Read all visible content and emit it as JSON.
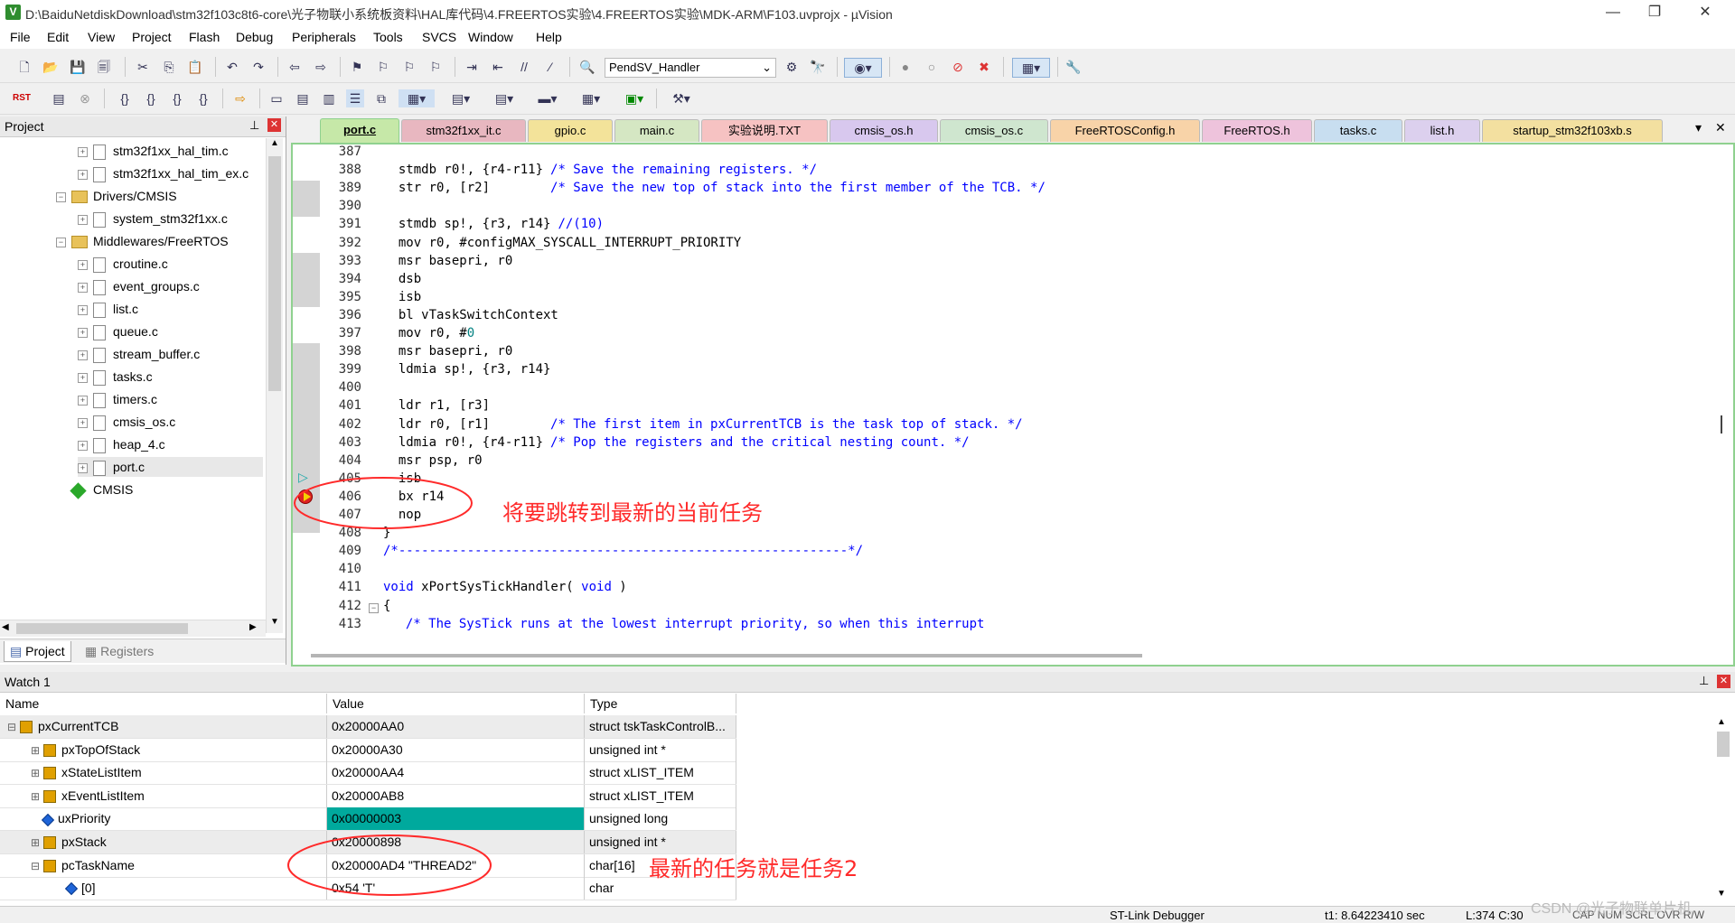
{
  "window": {
    "title": "D:\\BaiduNetdiskDownload\\stm32f103c8t6-core\\光子物联小系统板资料\\HAL库代码\\4.FREERTOS实验\\4.FREERTOS实验\\MDK-ARM\\F103.uvprojx - µVision",
    "app_icon": "V",
    "minimize": "—",
    "maximize": "❐",
    "close": "✕"
  },
  "menu": [
    "File",
    "Edit",
    "View",
    "Project",
    "Flash",
    "Debug",
    "Peripherals",
    "Tools",
    "SVCS",
    "Window",
    "Help"
  ],
  "toolbar": {
    "function_combo": "PendSV_Handler"
  },
  "project_panel": {
    "title": "Project",
    "pin": "⊥",
    "close": "✕",
    "tree": [
      {
        "label": "stm32f1xx_hal_tim.c",
        "type": "file"
      },
      {
        "label": "stm32f1xx_hal_tim_ex.c",
        "type": "file"
      },
      {
        "label": "Drivers/CMSIS",
        "type": "folder"
      },
      {
        "label": "system_stm32f1xx.c",
        "type": "file"
      },
      {
        "label": "Middlewares/FreeRTOS",
        "type": "folder"
      },
      {
        "label": "croutine.c",
        "type": "file"
      },
      {
        "label": "event_groups.c",
        "type": "file"
      },
      {
        "label": "list.c",
        "type": "file"
      },
      {
        "label": "queue.c",
        "type": "file"
      },
      {
        "label": "stream_buffer.c",
        "type": "file"
      },
      {
        "label": "tasks.c",
        "type": "file"
      },
      {
        "label": "timers.c",
        "type": "file"
      },
      {
        "label": "cmsis_os.c",
        "type": "file"
      },
      {
        "label": "heap_4.c",
        "type": "file"
      },
      {
        "label": "port.c",
        "type": "file"
      },
      {
        "label": "CMSIS",
        "type": "component"
      }
    ],
    "bottom_tabs": [
      "Project",
      "Registers"
    ]
  },
  "editor": {
    "tabs": [
      {
        "label": "port.c",
        "color": "#c6e8a8",
        "active": true
      },
      {
        "label": "stm32f1xx_it.c",
        "color": "#e8b7c0"
      },
      {
        "label": "gpio.c",
        "color": "#f3e39a"
      },
      {
        "label": "main.c",
        "color": "#d5e7c3"
      },
      {
        "label": "实验说明.TXT",
        "color": "#f6c2c2"
      },
      {
        "label": "cmsis_os.h",
        "color": "#d8c8ee"
      },
      {
        "label": "cmsis_os.c",
        "color": "#cfe6cf"
      },
      {
        "label": "FreeRTOSConfig.h",
        "color": "#f8d3a8"
      },
      {
        "label": "FreeRTOS.h",
        "color": "#eec3dc"
      },
      {
        "label": "tasks.c",
        "color": "#c8def0"
      },
      {
        "label": "list.h",
        "color": "#dcd0ee"
      },
      {
        "label": "startup_stm32f103xb.s",
        "color": "#f3e0a0"
      }
    ],
    "tab_menu": "▾",
    "tab_close": "✕",
    "lines": [
      {
        "n": "387",
        "code": ""
      },
      {
        "n": "388",
        "code": "  stmdb r0!, {r4-r11}",
        "comment": "/* Save the remaining registers. */"
      },
      {
        "n": "389",
        "code": "  str r0, [r2]       ",
        "comment": "/* Save the new top of stack into the first member of the TCB. */"
      },
      {
        "n": "390",
        "code": ""
      },
      {
        "n": "391",
        "code": "  stmdb sp!, {r3, r14}",
        "comment": "//(10)"
      },
      {
        "n": "392",
        "code": "  mov r0, #configMAX_SYSCALL_INTERRUPT_PRIORITY"
      },
      {
        "n": "393",
        "code": "  msr basepri, r0"
      },
      {
        "n": "394",
        "code": "  dsb"
      },
      {
        "n": "395",
        "code": "  isb"
      },
      {
        "n": "396",
        "code": "  bl vTaskSwitchContext"
      },
      {
        "n": "397",
        "code": "  mov r0, #",
        "number": "0"
      },
      {
        "n": "398",
        "code": "  msr basepri, r0"
      },
      {
        "n": "399",
        "code": "  ldmia sp!, {r3, r14}"
      },
      {
        "n": "400",
        "code": ""
      },
      {
        "n": "401",
        "code": "  ldr r1, [r3]"
      },
      {
        "n": "402",
        "code": "  ldr r0, [r1]       ",
        "comment": "/* The first item in pxCurrentTCB is the task top of stack. */"
      },
      {
        "n": "403",
        "code": "  ldmia r0!, {r4-r11}",
        "comment": "/* Pop the registers and the critical nesting count. */"
      },
      {
        "n": "404",
        "code": "  msr psp, r0"
      },
      {
        "n": "405",
        "code": "  isb"
      },
      {
        "n": "406",
        "code": "  bx r14"
      },
      {
        "n": "407",
        "code": "  nop"
      },
      {
        "n": "408",
        "code": "}"
      },
      {
        "n": "409",
        "code": "",
        "comment": "/*-----------------------------------------------------------*/"
      },
      {
        "n": "410",
        "code": ""
      },
      {
        "n": "411",
        "keyword": "void",
        "code": " xPortSysTickHandler( ",
        "keyword2": "void",
        "code2": " )"
      },
      {
        "n": "412",
        "code": "{"
      },
      {
        "n": "413",
        "code": "  ",
        "comment": "/* The SysTick runs at the lowest interrupt priority, so when this interrupt"
      }
    ],
    "annotation": "将要跳转到最新的当前任务"
  },
  "watch": {
    "title": "Watch 1",
    "pin": "⊥",
    "close": "✕",
    "columns": [
      "Name",
      "Value",
      "Type"
    ],
    "rows": [
      {
        "name": "pxCurrentTCB",
        "value": "0x20000AA0",
        "type": "struct tskTaskControlB...",
        "expand": "⊟",
        "level": 0
      },
      {
        "name": "pxTopOfStack",
        "value": "0x20000A30",
        "type": "unsigned int *",
        "expand": "⊞",
        "level": 1
      },
      {
        "name": "xStateListItem",
        "value": "0x20000AA4",
        "type": "struct xLIST_ITEM",
        "expand": "⊞",
        "level": 1
      },
      {
        "name": "xEventListItem",
        "value": "0x20000AB8",
        "type": "struct xLIST_ITEM",
        "expand": "⊞",
        "level": 1
      },
      {
        "name": "uxPriority",
        "value": "0x00000003",
        "type": "unsigned long",
        "expand": "",
        "level": 1,
        "highlight": true
      },
      {
        "name": "pxStack",
        "value": "0x20000898",
        "type": "unsigned int *",
        "expand": "⊞",
        "level": 1
      },
      {
        "name": "pcTaskName",
        "value": "0x20000AD4 \"THREAD2\"",
        "type": "char[16]",
        "expand": "⊟",
        "level": 1
      },
      {
        "name": "[0]",
        "value": "0x54 'T'",
        "type": "char",
        "expand": "",
        "level": 2
      }
    ],
    "annotation": "最新的任务就是任务2"
  },
  "status": {
    "debugger": "ST-Link Debugger",
    "time": "t1: 8.64223410 sec",
    "position": "L:374 C:30",
    "flags": "CAP NUM SCRL OVR R/W",
    "watermark": "CSDN @光子物联单片机"
  },
  "colors": {
    "editor_border": "#8fd18f",
    "highlight": "#00a99d",
    "annotation": "#ff2a2a"
  }
}
